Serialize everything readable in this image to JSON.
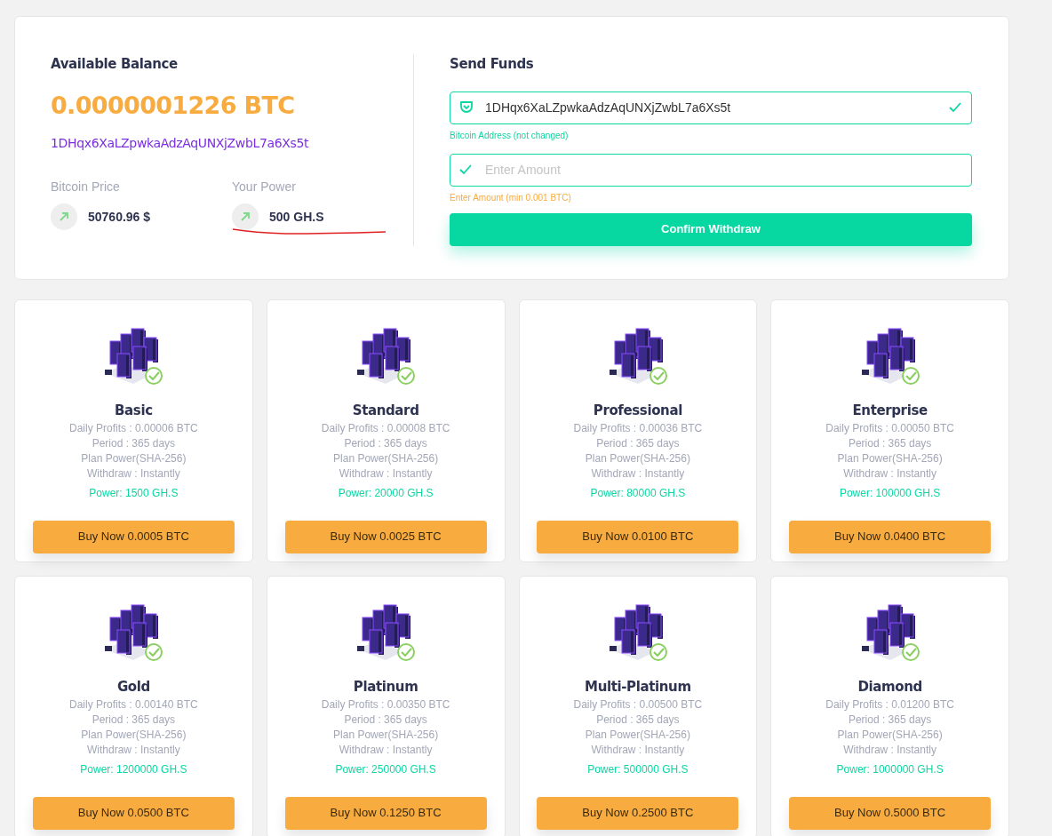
{
  "balance": {
    "title": "Available Balance",
    "amount": "0.0000001226 BTC",
    "address": "1DHqx6XaLZpwkaAdzAqUNXjZwbL7a6Xs5t"
  },
  "stats": [
    {
      "label": "Bitcoin Price",
      "value": "50760.96 $"
    },
    {
      "label": "Your Power",
      "value": "500 GH.S"
    }
  ],
  "send_funds": {
    "title": "Send Funds",
    "address_field": {
      "value": "1DHqx6XaLZpwkaAdzAqUNXjZwbL7a6Xs5t",
      "hint": "Bitcoin Address (not changed)"
    },
    "amount_field": {
      "placeholder": "Enter Amount",
      "hint": "Enter Amount (min 0.001 BTC)"
    },
    "button": "Confirm Withdraw"
  },
  "plans": [
    {
      "name": "Basic",
      "lines": [
        "Daily Profits : 0.00006 BTC",
        "Period : 365 days",
        "Plan Power(SHA-256)",
        "Withdraw : Instantly"
      ],
      "power": "Power: 1500 GH.S",
      "button": "Buy Now 0.0005 BTC"
    },
    {
      "name": "Standard",
      "lines": [
        "Daily Profits : 0.00008 BTC",
        "Period : 365 days",
        "Plan Power(SHA-256)",
        "Withdraw : Instantly"
      ],
      "power": "Power: 20000 GH.S",
      "button": "Buy Now 0.0025 BTC"
    },
    {
      "name": "Professional",
      "lines": [
        "Daily Profits : 0.00036 BTC",
        "Period : 365 days",
        "Plan Power(SHA-256)",
        "Withdraw : Instantly"
      ],
      "power": "Power: 80000 GH.S",
      "button": "Buy Now 0.0100 BTC"
    },
    {
      "name": "Enterprise",
      "lines": [
        "Daily Profits : 0.00050 BTC",
        "Period : 365 days",
        "Plan Power(SHA-256)",
        "Withdraw : Instantly"
      ],
      "power": "Power: 100000 GH.S",
      "button": "Buy Now 0.0400 BTC"
    },
    {
      "name": "Gold",
      "lines": [
        "Daily Profits : 0.00140 BTC",
        "Period : 365 days",
        "Plan Power(SHA-256)",
        "Withdraw : Instantly"
      ],
      "power": "Power: 1200000 GH.S",
      "button": "Buy Now 0.0500 BTC"
    },
    {
      "name": "Platinum",
      "lines": [
        "Daily Profits : 0.00350 BTC",
        "Period : 365 days",
        "Plan Power(SHA-256)",
        "Withdraw : Instantly"
      ],
      "power": "Power: 250000 GH.S",
      "button": "Buy Now 0.1250 BTC"
    },
    {
      "name": "Multi-Platinum",
      "lines": [
        "Daily Profits : 0.00500 BTC",
        "Period : 365 days",
        "Plan Power(SHA-256)",
        "Withdraw : Instantly"
      ],
      "power": "Power: 500000 GH.S",
      "button": "Buy Now 0.2500 BTC"
    },
    {
      "name": "Diamond",
      "lines": [
        "Daily Profits : 0.01200 BTC",
        "Period : 365 days",
        "Plan Power(SHA-256)",
        "Withdraw : Instantly"
      ],
      "power": "Power: 1000000 GH.S",
      "button": "Buy Now 0.5000 BTC"
    }
  ]
}
